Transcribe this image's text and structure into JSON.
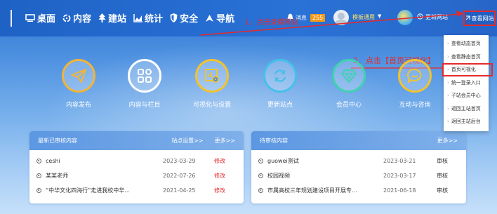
{
  "nav": [
    {
      "label": "桌面",
      "icon": "desktop-icon"
    },
    {
      "label": "内容",
      "icon": "recycle-icon"
    },
    {
      "label": "建站",
      "icon": "tree-icon"
    },
    {
      "label": "统计",
      "icon": "bar-chart-icon"
    },
    {
      "label": "安全",
      "icon": "shield-icon"
    },
    {
      "label": "导航",
      "icon": "compass-icon"
    }
  ],
  "header": {
    "messages_label": "消息",
    "messages_count": "255",
    "template_label": "模板通用",
    "update_label": "更新网站",
    "view_site_label": "查看网站"
  },
  "annotations": {
    "step1": "1、点击查看网站",
    "step2": "2、点击【首页可视化】"
  },
  "features": [
    {
      "label": "内容发布",
      "icon": "send-icon",
      "color": "#f2b43a"
    },
    {
      "label": "内容与栏目",
      "icon": "grid-icon",
      "color": "#ffffff"
    },
    {
      "label": "可视化与设置",
      "icon": "visual-settings-icon",
      "color": "#f2c230"
    },
    {
      "label": "更新站点",
      "icon": "refresh-icon",
      "color": "#45c1e8"
    },
    {
      "label": "会员中心",
      "icon": "diamond-icon",
      "color": "#40d2b0"
    },
    {
      "label": "互动与咨询",
      "icon": "chat-icon",
      "color": "#f2c230"
    }
  ],
  "recent_panel": {
    "title": "最新已审核内容",
    "settings_link": "站点设置>>",
    "more_link": "更多>>",
    "rows": [
      {
        "title": "ceshi",
        "date": "2023-03-29",
        "action": "修改"
      },
      {
        "title": "某某老师",
        "date": "2022-07-26",
        "action": "修改"
      },
      {
        "title": "“中华文化四海行”走进我校中华...",
        "date": "2021-04-25",
        "action": "修改"
      }
    ]
  },
  "pending_panel": {
    "title": "待审核内容",
    "more_link": "更多>>",
    "rows": [
      {
        "title": "guowei测试",
        "date": "2023-03-21",
        "action": "审核"
      },
      {
        "title": "校园视频",
        "date": "2023-03-17",
        "action": "审核"
      },
      {
        "title": "市属高校三年规划建设项目开展专...",
        "date": "2021-06-18",
        "action": "审核"
      }
    ]
  },
  "dropdown": {
    "items": [
      "查看动态首页",
      "查看静态首页",
      "首页可视化",
      "统一登录入口",
      "子站会员中心",
      "返回主站首页",
      "返回主站后台"
    ],
    "highlighted_index": 2
  },
  "colors": {
    "topbar": "#2a72d6",
    "annotation_red": "#e52a2a",
    "action_red": "#e52a2a",
    "badge_orange": "#f39a1b",
    "template_yellow": "#ffe066"
  }
}
